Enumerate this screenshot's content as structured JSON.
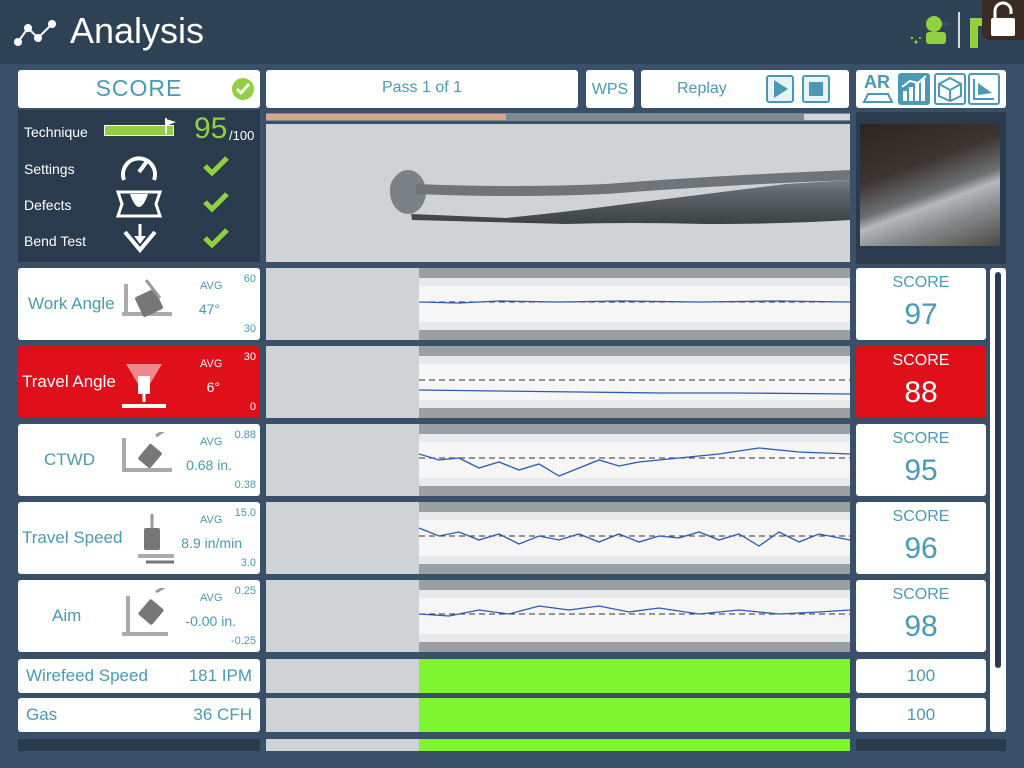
{
  "header": {
    "title": "Analysis"
  },
  "score_panel": {
    "label": "SCORE",
    "technique": {
      "label": "Technique",
      "score": "95",
      "out_of": "/100",
      "fill": 0.95
    },
    "settings": {
      "label": "Settings"
    },
    "defects": {
      "label": "Defects"
    },
    "bend_test": {
      "label": "Bend Test"
    }
  },
  "toolbar": {
    "pass": "Pass 1 of 1",
    "wps": "WPS",
    "replay": "Replay",
    "ar": "AR"
  },
  "metrics": [
    {
      "name": "Work Angle",
      "avg_label": "AVG",
      "avg": "47°",
      "hi": "60",
      "lo": "30",
      "score_label": "SCORE",
      "score": "97",
      "status": "ok"
    },
    {
      "name": "Travel Angle",
      "avg_label": "AVG",
      "avg": "6°",
      "hi": "30",
      "lo": "0",
      "score_label": "SCORE",
      "score": "88",
      "status": "alert"
    },
    {
      "name": "CTWD",
      "avg_label": "AVG",
      "avg": "0.68 in.",
      "hi": "0.88",
      "lo": "0.38",
      "score_label": "SCORE",
      "score": "95",
      "status": "ok"
    },
    {
      "name": "Travel Speed",
      "avg_label": "AVG",
      "avg": "8.9 in/min",
      "hi": "15.0",
      "lo": "3.0",
      "score_label": "SCORE",
      "score": "96",
      "status": "ok"
    },
    {
      "name": "Aim",
      "avg_label": "AVG",
      "avg": "-0.00 in.",
      "hi": "0.25",
      "lo": "-0.25",
      "score_label": "SCORE",
      "score": "98",
      "status": "ok"
    }
  ],
  "settings_rows": [
    {
      "name": "Wirefeed Speed",
      "value": "181 IPM",
      "score": "100"
    },
    {
      "name": "Gas",
      "value": "36 CFH",
      "score": "100"
    }
  ],
  "colors": {
    "accent": "#4a9ab7",
    "alert": "#e0101b",
    "good": "#8fd13e",
    "panel_dark": "#2a3b4d"
  }
}
